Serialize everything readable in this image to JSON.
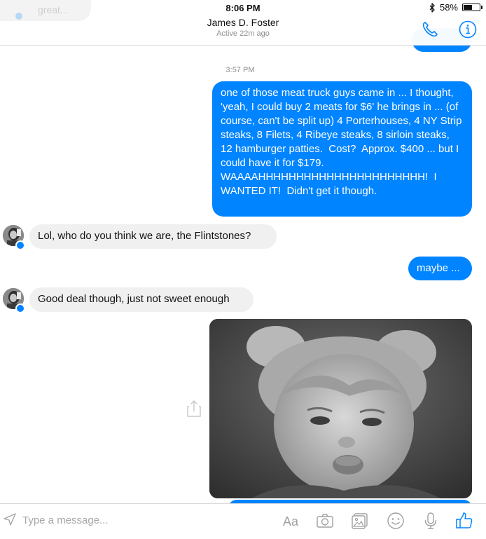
{
  "status_bar": {
    "time": "8:06 PM",
    "battery": "58%",
    "battery_level": 0.58
  },
  "previous_message_peek": {
    "text": "great..."
  },
  "header": {
    "contact_name": "James D. Foster",
    "presence": "Active 22m ago"
  },
  "conversation": {
    "timestamp": "3:57 PM",
    "messages": [
      {
        "direction": "outgoing",
        "text": "one of those meat truck guys came in ... I thought, 'yeah, I could buy 2 meats for $6' he brings in ... (of course, can't be split up) 4 Porterhouses, 4 NY Strip steaks, 8 Filets, 4 Ribeye steaks, 8 sirloin steaks, 12 hamburger patties.  Cost?  Approx. $400 ... but I could have it for $179.  WAAAAHHHHHHHHHHHHHHHHHHHHHH!  I WANTED IT!  Didn't get it though."
      },
      {
        "direction": "incoming",
        "text": "Lol, who do you think we are, the Flintstones?"
      },
      {
        "direction": "outgoing",
        "text": "maybe ..."
      },
      {
        "direction": "incoming",
        "text": "Good deal though, just not sweet enough"
      },
      {
        "direction": "outgoing",
        "type": "photo",
        "subject": "black-and-white photo of a pouting toddler with pigtails"
      }
    ]
  },
  "composer": {
    "placeholder": "Type a message...",
    "text_format_label": "Aa"
  },
  "colors": {
    "accent": "#0084ff",
    "incoming_bubble": "#f1f0f0",
    "secondary_text": "#8e8e93",
    "icon_gray": "#a0a0a0"
  },
  "icons": {
    "header": [
      "phone-icon",
      "info-icon"
    ],
    "composer": [
      "send-icon",
      "text-format-icon",
      "camera-icon",
      "gallery-icon",
      "emoji-icon",
      "microphone-icon",
      "like-icon"
    ],
    "message_actions": [
      "share-icon"
    ]
  }
}
